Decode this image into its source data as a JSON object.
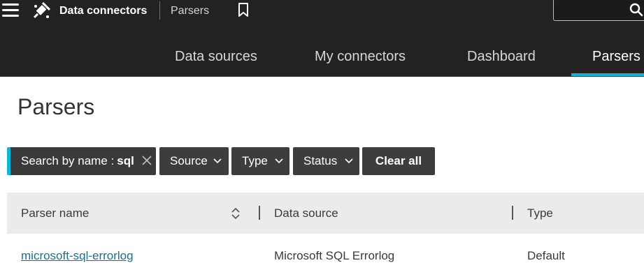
{
  "app": {
    "title": "Data connectors",
    "breadcrumb": "Parsers"
  },
  "tabs": [
    {
      "label": "Data sources",
      "active": false
    },
    {
      "label": "My connectors",
      "active": false
    },
    {
      "label": "Dashboard",
      "active": false
    },
    {
      "label": "Parsers",
      "active": true
    }
  ],
  "page": {
    "title": "Parsers"
  },
  "filters": {
    "search_label": "Search by name :",
    "search_value": "sql",
    "source_label": "Source",
    "type_label": "Type",
    "status_label": "Status",
    "clear_label": "Clear all"
  },
  "table": {
    "columns": [
      "Parser name",
      "Data source",
      "Type"
    ],
    "rows": [
      {
        "name": "microsoft-sql-errorlog",
        "source": "Microsoft SQL Errorlog",
        "type": "Default"
      }
    ]
  },
  "colors": {
    "topbar": "#222222",
    "accent": "#0bb5d6",
    "chip": "#3d3d3d",
    "link": "#1b6f8c",
    "table_header": "#ebebeb"
  },
  "icons": [
    "menu-icon",
    "plug-icon",
    "bookmark-icon",
    "search-icon",
    "close-icon",
    "chevron-down-icon",
    "sort-icon"
  ]
}
